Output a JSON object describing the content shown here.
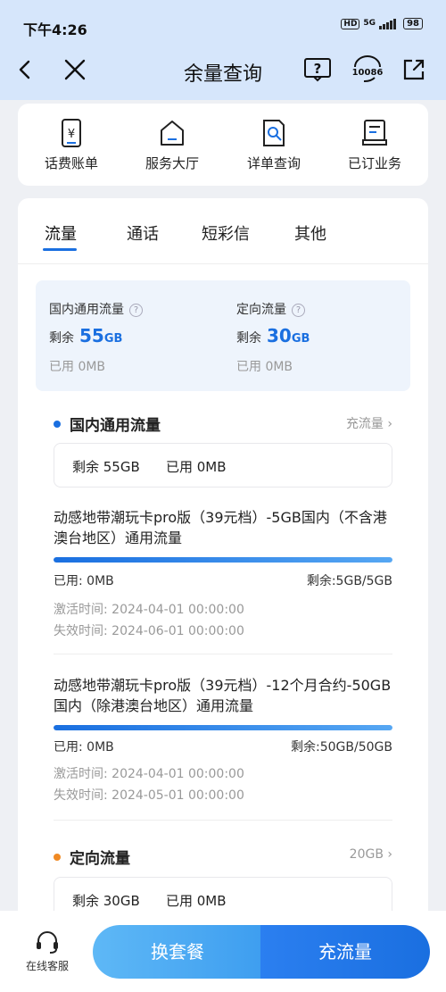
{
  "status": {
    "time": "下午4:26",
    "hd": "HD",
    "network": "5G",
    "battery": "98"
  },
  "nav": {
    "title": "余量查询",
    "hotline": "10086"
  },
  "quick": [
    {
      "label": "话费账单",
      "icon": "bill-phone-icon"
    },
    {
      "label": "服务大厅",
      "icon": "home-icon"
    },
    {
      "label": "详单查询",
      "icon": "detail-search-icon"
    },
    {
      "label": "已订业务",
      "icon": "subscribed-service-icon"
    }
  ],
  "tabs": [
    "流量",
    "通话",
    "短彩信",
    "其他"
  ],
  "summary": {
    "general": {
      "title": "国内通用流量",
      "remain_label": "剩余",
      "remain_value": "55",
      "remain_unit": "GB",
      "used": "已用  0MB"
    },
    "directed": {
      "title": "定向流量",
      "remain_label": "剩余",
      "remain_value": "30",
      "remain_unit": "GB",
      "used": "已用  0MB"
    }
  },
  "general_section": {
    "title": "国内通用流量",
    "link": "充流量",
    "chip_remain": "剩余 55GB",
    "chip_used": "已用 0MB",
    "color": "#1a6fe0"
  },
  "packages": [
    {
      "title": "动感地带潮玩卡pro版（39元档）-5GB国内（不含港澳台地区）通用流量",
      "used": "已用: 0MB",
      "remain": "剩余:5GB/5GB",
      "remaining_fraction": 1.0,
      "activated": "激活时间: 2024-04-01 00:00:00",
      "expires": "失效时间: 2024-06-01 00:00:00"
    },
    {
      "title": "动感地带潮玩卡pro版（39元档）-12个月合约-50GB国内（除港澳台地区）通用流量",
      "used": "已用: 0MB",
      "remain": "剩余:50GB/50GB",
      "remaining_fraction": 1.0,
      "activated": "激活时间: 2024-04-01 00:00:00",
      "expires": "失效时间: 2024-05-01 00:00:00"
    }
  ],
  "directed_section": {
    "title": "定向流量",
    "link": "20GB",
    "chip_remain": "剩余 30GB",
    "chip_used": "已用 0MB",
    "color": "#f08a24"
  },
  "bottom": {
    "service_label": "在线客服",
    "change_plan": "换套餐",
    "recharge": "充流量"
  }
}
